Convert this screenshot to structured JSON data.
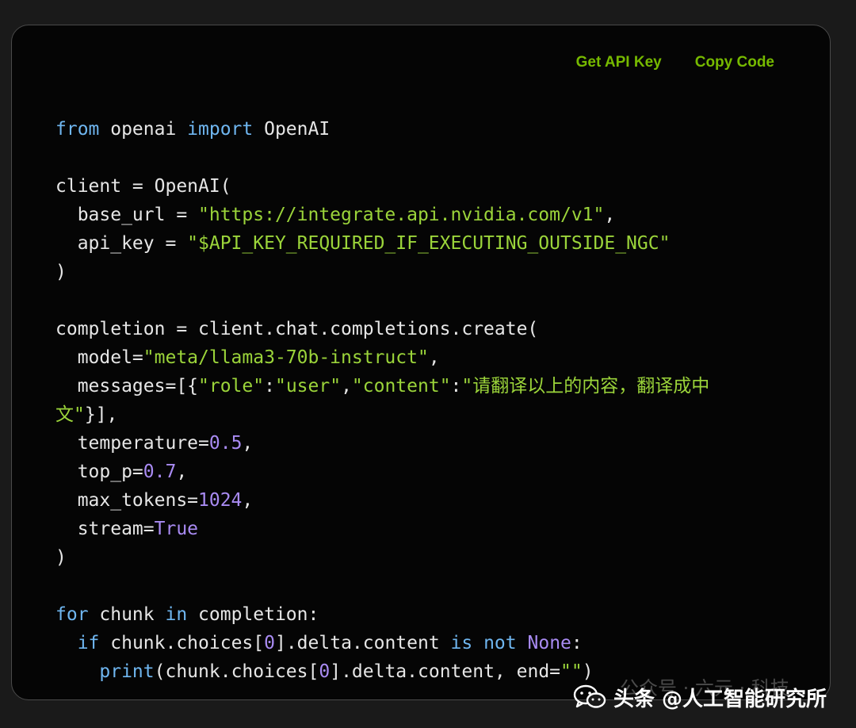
{
  "header": {
    "get_api_key": "Get API Key",
    "copy_code": "Copy Code"
  },
  "code": {
    "l1": {
      "k1": "from",
      "t1": " openai ",
      "k2": "import",
      "t2": " OpenAI"
    },
    "l3": "client = OpenAI(",
    "l4": {
      "t1": "  base_url = ",
      "s1": "\"https://integrate.api.nvidia.com/v1\"",
      "t2": ","
    },
    "l5": {
      "t1": "  api_key = ",
      "s1": "\"$API_KEY_REQUIRED_IF_EXECUTING_OUTSIDE_NGC\""
    },
    "l6": ")",
    "l8": "completion = client.chat.completions.create(",
    "l9": {
      "t1": "  model=",
      "s1": "\"meta/llama3-70b-instruct\"",
      "t2": ","
    },
    "l10": {
      "t1": "  messages=[{",
      "s1": "\"role\"",
      "t2": ":",
      "s2": "\"user\"",
      "t3": ",",
      "s3": "\"content\"",
      "t4": ":",
      "s4": "\"请翻译以上的内容，翻译成中"
    },
    "l11": {
      "s1": "文\"",
      "t1": "}],"
    },
    "l12": {
      "t1": "  temperature=",
      "n1": "0.5",
      "t2": ","
    },
    "l13": {
      "t1": "  top_p=",
      "n1": "0.7",
      "t2": ","
    },
    "l14": {
      "t1": "  max_tokens=",
      "n1": "1024",
      "t2": ","
    },
    "l15": {
      "t1": "  stream=",
      "n1": "True"
    },
    "l16": ")",
    "l18": {
      "k1": "for",
      "t1": " chunk ",
      "k2": "in",
      "t2": " completion:"
    },
    "l19": {
      "t0": "  ",
      "k1": "if",
      "t1": " chunk.choices[",
      "n1": "0",
      "t2": "].delta.content ",
      "k2": "is not",
      "t3": " ",
      "n2": "None",
      "t4": ":"
    },
    "l20": {
      "t0": "    ",
      "f1": "print",
      "t1": "(chunk.choices[",
      "n1": "0",
      "t2": "].delta.content, end=",
      "s1": "\"\"",
      "t3": ")"
    }
  },
  "watermark": {
    "icon": "wechat-icon",
    "ghost_text": "公众号 · 六元 · 科技",
    "text": "头条 @人工智能研究所"
  },
  "colors": {
    "accent": "#76b900",
    "keyword": "#6fb6f0",
    "string": "#9bd43a",
    "number": "#a98bf3",
    "text": "#e6e6e6",
    "background": "#050505"
  }
}
